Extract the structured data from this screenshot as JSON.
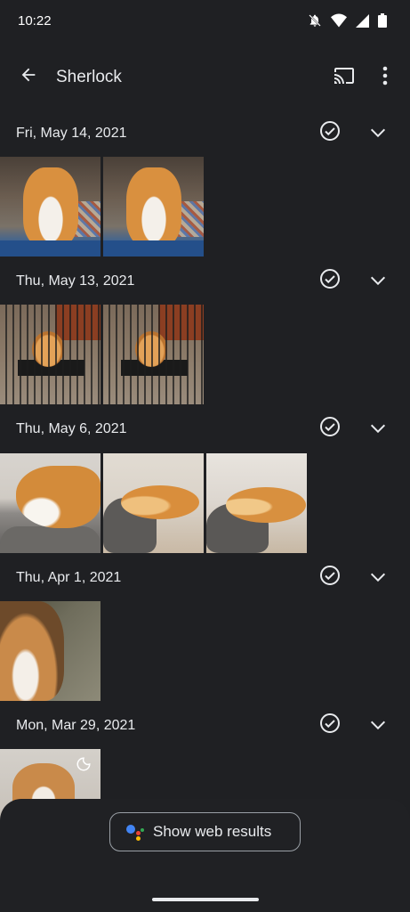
{
  "status_bar": {
    "time": "10:22"
  },
  "app_bar": {
    "title": "Sherlock"
  },
  "groups": [
    {
      "date": "Fri, May 14, 2021"
    },
    {
      "date": "Thu, May 13, 2021"
    },
    {
      "date": "Thu, May 6, 2021"
    },
    {
      "date": "Thu, Apr 1, 2021"
    },
    {
      "date": "Mon, Mar 29, 2021"
    }
  ],
  "bottom_sheet": {
    "web_results_label": "Show web results"
  },
  "colors": {
    "background": "#1f2023",
    "text": "#e8eaed",
    "assistant_blue": "#4285f4",
    "assistant_red": "#ea4335",
    "assistant_yellow": "#fbbc04",
    "assistant_green": "#34a853"
  },
  "icons": [
    "back-arrow-icon",
    "cast-icon",
    "more-vert-icon",
    "check-circle-icon",
    "chevron-down-icon",
    "do-not-disturb-icon",
    "wifi-icon",
    "signal-icon",
    "battery-icon",
    "moon-icon",
    "google-assistant-icon"
  ]
}
